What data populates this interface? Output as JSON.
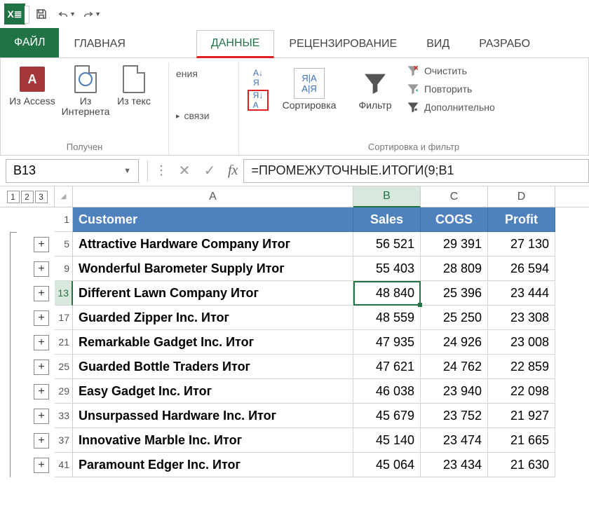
{
  "qat": {
    "save_title": "Сохранить",
    "undo_title": "Отменить",
    "redo_title": "Повторить"
  },
  "tabs": {
    "file": "ФАЙЛ",
    "home": "ГЛАВНАЯ",
    "data": "ДАННЫЕ",
    "review": "РЕЦЕНЗИРОВАНИЕ",
    "view": "ВИД",
    "dev": "РАЗРАБО"
  },
  "ribbon": {
    "get": {
      "access": "Из Access",
      "web": "Из Интернета",
      "text": "Из текс",
      "group": "Получен"
    },
    "conn": {
      "item1": "ения",
      "item2": "связи"
    },
    "sort": {
      "sort_btn": "Сортировка",
      "filter_btn": "Фильтр",
      "clear": "Очистить",
      "reapply": "Повторить",
      "advanced": "Дополнительно",
      "group": "Сортировка и фильтр"
    }
  },
  "namebox": "B13",
  "formula": "=ПРОМЕЖУТОЧНЫЕ.ИТОГИ(9;В1",
  "outline_levels": [
    "1",
    "2",
    "3"
  ],
  "columns": [
    "A",
    "B",
    "C",
    "D"
  ],
  "headers": {
    "a": "Customer",
    "b": "Sales",
    "c": "COGS",
    "d": "Profit"
  },
  "rows": [
    {
      "n": "5",
      "a": "Attractive Hardware Company Итог",
      "b": "56 521",
      "c": "29 391",
      "d": "27 130"
    },
    {
      "n": "9",
      "a": "Wonderful Barometer Supply Итог",
      "b": "55 403",
      "c": "28 809",
      "d": "26 594"
    },
    {
      "n": "13",
      "a": "Different Lawn Company Итог",
      "b": "48 840",
      "c": "25 396",
      "d": "23 444",
      "active": true
    },
    {
      "n": "17",
      "a": "Guarded Zipper Inc. Итог",
      "b": "48 559",
      "c": "25 250",
      "d": "23 308"
    },
    {
      "n": "21",
      "a": "Remarkable Gadget Inc. Итог",
      "b": "47 935",
      "c": "24 926",
      "d": "23 008"
    },
    {
      "n": "25",
      "a": "Guarded Bottle Traders Итог",
      "b": "47 621",
      "c": "24 762",
      "d": "22 859"
    },
    {
      "n": "29",
      "a": "Easy Gadget Inc. Итог",
      "b": "46 038",
      "c": "23 940",
      "d": "22 098"
    },
    {
      "n": "33",
      "a": "Unsurpassed Hardware Inc. Итог",
      "b": "45 679",
      "c": "23 752",
      "d": "21 927"
    },
    {
      "n": "37",
      "a": "Innovative Marble Inc. Итог",
      "b": "45 140",
      "c": "23 474",
      "d": "21 665"
    },
    {
      "n": "41",
      "a": "Paramount Edger Inc. Итог",
      "b": "45 064",
      "c": "23 434",
      "d": "21 630"
    }
  ]
}
